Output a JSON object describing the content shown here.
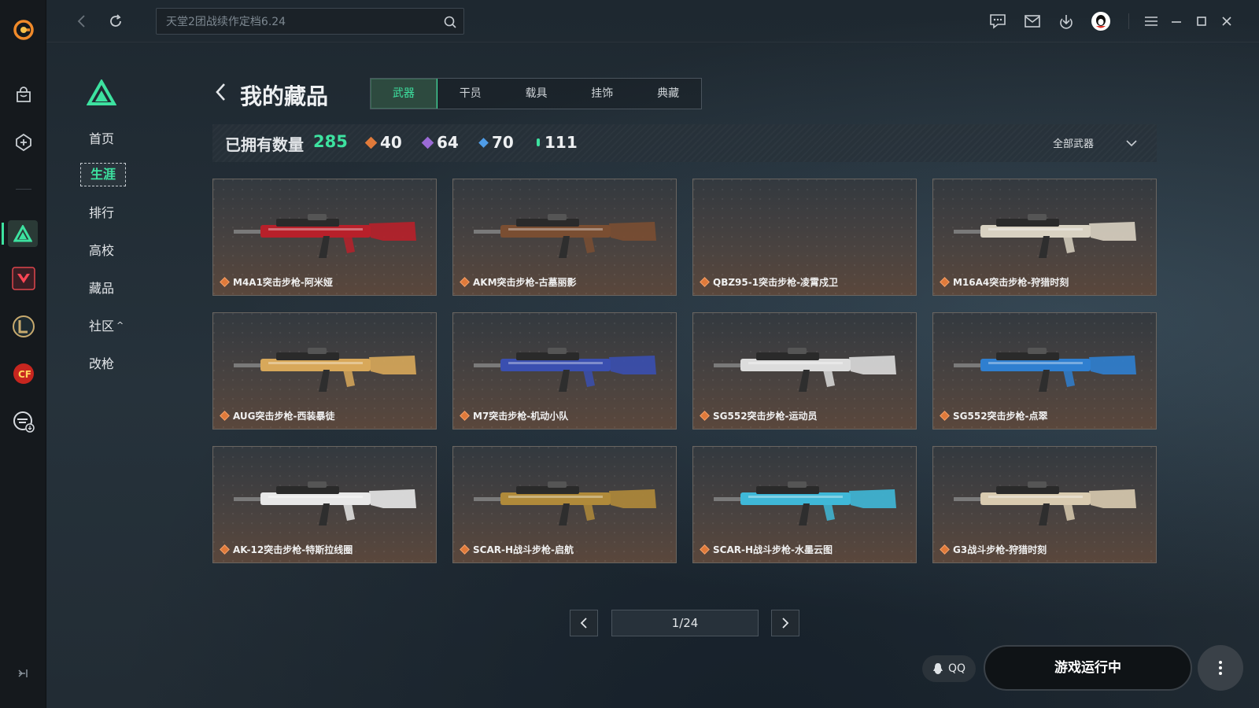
{
  "topbar": {
    "search_value": "天堂2团战续作定档6.24"
  },
  "sidebar": {
    "items": [
      {
        "label": "首页"
      },
      {
        "label": "生涯"
      },
      {
        "label": "排行"
      },
      {
        "label": "高校"
      },
      {
        "label": "藏品"
      },
      {
        "label": "社区"
      },
      {
        "label": "改枪"
      }
    ],
    "active": "生涯",
    "community_chevron": "^"
  },
  "header": {
    "title": "我的藏品",
    "tabs": [
      {
        "label": "武器"
      },
      {
        "label": "干员"
      },
      {
        "label": "载具"
      },
      {
        "label": "挂饰"
      },
      {
        "label": "典藏"
      }
    ],
    "active_tab": "武器"
  },
  "stats": {
    "owned_label": "已拥有数量",
    "owned_count": "285",
    "tiers": [
      {
        "value": "40",
        "color": "#e07a3a"
      },
      {
        "value": "64",
        "color": "#9b6bd6"
      },
      {
        "value": "70",
        "color": "#4f9de8"
      },
      {
        "value": "111",
        "color": "#3de2a0"
      }
    ],
    "filter_label": "全部武器"
  },
  "items": [
    {
      "name": "M4A1突击步枪-阿米娅",
      "accent": "#b8202a"
    },
    {
      "name": "AKM突击步枪-古墓丽影",
      "accent": "#7a4e32"
    },
    {
      "name": "QBZ95-1突击步枪-凌霄戍卫",
      "accent": ""
    },
    {
      "name": "M16A4突击步枪-狩猎时刻",
      "accent": "#d9d2c2"
    },
    {
      "name": "AUG突击步枪-西装暴徒",
      "accent": "#d8a85a"
    },
    {
      "name": "M7突击步枪-机动小队",
      "accent": "#3a4fb0"
    },
    {
      "name": "SG552突击步枪-运动员",
      "accent": "#dcdcdc"
    },
    {
      "name": "SG552突击步枪-点翠",
      "accent": "#2f7fd0"
    },
    {
      "name": "AK-12突击步枪-特斯拉线圈",
      "accent": "#e8e8e8"
    },
    {
      "name": "SCAR-H战斗步枪-启航",
      "accent": "#b08a3a"
    },
    {
      "name": "SCAR-H战斗步枪-水墨云图",
      "accent": "#3fb8d8"
    },
    {
      "name": "G3战斗步枪-狩猎时刻",
      "accent": "#d9cbb0"
    }
  ],
  "pagination": {
    "page": "1/24"
  },
  "footer": {
    "qq_label": "QQ",
    "run_label": "游戏运行中"
  }
}
